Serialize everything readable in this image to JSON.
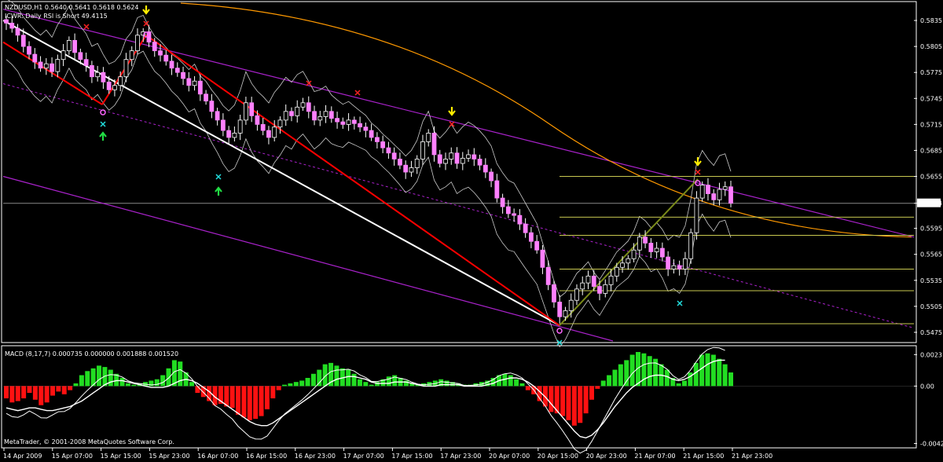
{
  "chart_data": {
    "type": "candlestick",
    "header": {
      "symbol_line": "NZDUSD,H1  0.5640 0.5641 0.5618 0.5624",
      "indicator_line": "ICWR: Daily RSI is Short 49.4115"
    },
    "price_axis": {
      "ticks": [
        "0.5835",
        "0.5805",
        "0.5775",
        "0.5745",
        "0.5715",
        "0.5685",
        "0.5655",
        "0.5624",
        "0.5595",
        "0.5565",
        "0.5535",
        "0.5505",
        "0.5475"
      ],
      "current_price": "0.5624",
      "ylim": [
        0.5465,
        0.5855
      ]
    },
    "macd": {
      "label": "MACD  (8,17,7) 0.000735 0.000000 0.001888 0.001520",
      "ticks": [
        "0.00231",
        "0.00",
        "-0.00421"
      ],
      "ylim": [
        -0.0043,
        0.0025
      ],
      "histogram": [
        -0.0009,
        -0.0012,
        -0.0011,
        -0.0009,
        -0.0005,
        -0.001,
        -0.0014,
        -0.0012,
        -0.0007,
        -0.0004,
        -0.0006,
        -0.0003,
        0.0002,
        0.0008,
        0.0011,
        0.0013,
        0.0015,
        0.0014,
        0.0012,
        0.0009,
        0.0006,
        0.0002,
        0.0001,
        0.0002,
        0.0003,
        0.0004,
        0.0005,
        0.0008,
        0.0013,
        0.0019,
        0.0018,
        0.001,
        0.0003,
        -0.0005,
        -0.0008,
        -0.0011,
        -0.0014,
        -0.0013,
        -0.0015,
        -0.0016,
        -0.0021,
        -0.0023,
        -0.0025,
        -0.0024,
        -0.0022,
        -0.0017,
        -0.0009,
        -0.0003,
        0.0001,
        0.0002,
        0.0003,
        0.0004,
        0.0006,
        0.0009,
        0.0012,
        0.0016,
        0.0017,
        0.0015,
        0.0013,
        0.0012,
        0.0009,
        0.0005,
        0.0003,
        0.0001,
        0.0003,
        0.0005,
        0.0007,
        0.0008,
        0.0006,
        0.0004,
        0.0002,
        0.0001,
        0.0002,
        0.0003,
        0.0004,
        0.0005,
        0.0004,
        0.0003,
        0.0002,
        0.0001,
        0.0001,
        0.0002,
        0.0003,
        0.0004,
        0.0006,
        0.0008,
        0.0009,
        0.0008,
        0.0005,
        0.0002,
        -0.0003,
        -0.0006,
        -0.0011,
        -0.0015,
        -0.0019,
        -0.002,
        -0.0022,
        -0.0025,
        -0.0029,
        -0.0027,
        -0.002,
        -0.001,
        -0.0002,
        0.0004,
        0.0008,
        0.0012,
        0.0016,
        0.0019,
        0.0023,
        0.0025,
        0.0024,
        0.0022,
        0.002,
        0.0016,
        0.0012,
        0.0006,
        0.0002,
        0.0004,
        0.001,
        0.0017,
        0.0023,
        0.0024,
        0.0023,
        0.002,
        0.0016,
        0.001
      ],
      "signal": [
        -0.0016,
        -0.0017,
        -0.0018,
        -0.0017,
        -0.0016,
        -0.0016,
        -0.0017,
        -0.0018,
        -0.0018,
        -0.0017,
        -0.0016,
        -0.0015,
        -0.0013,
        -0.0011,
        -0.0008,
        -0.0005,
        -0.0002,
        0.0001,
        0.0003,
        0.0004,
        0.0004,
        0.0003,
        0.0002,
        0.0001,
        0.0,
        -0.0001,
        -0.0001,
        -0.0001,
        0.0,
        0.0002,
        0.0004,
        0.0005,
        0.0004,
        0.0002,
        -0.0001,
        -0.0004,
        -0.0008,
        -0.0011,
        -0.0014,
        -0.0017,
        -0.002,
        -0.0023,
        -0.0026,
        -0.0028,
        -0.0029,
        -0.0029,
        -0.0027,
        -0.0024,
        -0.0021,
        -0.0018,
        -0.0015,
        -0.0012,
        -0.0009,
        -0.0006,
        -0.0003,
        0.0,
        0.0003,
        0.0005,
        0.0006,
        0.0007,
        0.0007,
        0.0006,
        0.0005,
        0.0003,
        0.0002,
        0.0002,
        0.0002,
        0.0003,
        0.0003,
        0.0003,
        0.0002,
        0.0001,
        0.0,
        0.0,
        0.0,
        0.0001,
        0.0001,
        0.0001,
        0.0001,
        0.0,
        0.0,
        0.0,
        0.0,
        0.0001,
        0.0002,
        0.0004,
        0.0005,
        0.0006,
        0.0006,
        0.0005,
        0.0003,
        0.0,
        -0.0004,
        -0.0008,
        -0.0013,
        -0.0018,
        -0.0023,
        -0.0028,
        -0.0033,
        -0.0037,
        -0.0038,
        -0.0036,
        -0.0032,
        -0.0027,
        -0.0021,
        -0.0015,
        -0.001,
        -0.0005,
        -0.0001,
        0.0002,
        0.0005,
        0.0007,
        0.0008,
        0.0008,
        0.0007,
        0.0005,
        0.0004,
        0.0005,
        0.0007,
        0.001,
        0.0013,
        0.0016,
        0.0018,
        0.0019,
        0.0019
      ]
    },
    "time_axis": {
      "labels": [
        "14 Apr 2009",
        "15 Apr 07:00",
        "15 Apr 15:00",
        "15 Apr 23:00",
        "16 Apr 07:00",
        "16 Apr 15:00",
        "16 Apr 23:00",
        "17 Apr 07:00",
        "17 Apr 15:00",
        "17 Apr 23:00",
        "20 Apr 07:00",
        "20 Apr 15:00",
        "20 Apr 23:00",
        "21 Apr 07:00",
        "21 Apr 15:00",
        "21 Apr 23:00"
      ]
    },
    "candles_close": [
      0.5832,
      0.5826,
      0.5818,
      0.5805,
      0.5796,
      0.5787,
      0.578,
      0.5785,
      0.5776,
      0.579,
      0.58,
      0.5812,
      0.5798,
      0.579,
      0.5783,
      0.577,
      0.5775,
      0.5764,
      0.5755,
      0.576,
      0.577,
      0.579,
      0.58,
      0.5818,
      0.5822,
      0.581,
      0.58,
      0.5795,
      0.5788,
      0.578,
      0.5775,
      0.5768,
      0.576,
      0.5765,
      0.575,
      0.5742,
      0.573,
      0.572,
      0.5708,
      0.57,
      0.5705,
      0.572,
      0.574,
      0.5725,
      0.5715,
      0.5708,
      0.57,
      0.5712,
      0.572,
      0.573,
      0.5725,
      0.5735,
      0.574,
      0.573,
      0.572,
      0.5724,
      0.573,
      0.5722,
      0.5718,
      0.5715,
      0.572,
      0.5716,
      0.5712,
      0.5708,
      0.57,
      0.5695,
      0.5688,
      0.5682,
      0.5675,
      0.5668,
      0.566,
      0.5665,
      0.5675,
      0.5695,
      0.5705,
      0.568,
      0.567,
      0.5675,
      0.5682,
      0.567,
      0.5676,
      0.568,
      0.5675,
      0.5668,
      0.566,
      0.565,
      0.563,
      0.562,
      0.5612,
      0.561,
      0.56,
      0.559,
      0.558,
      0.557,
      0.555,
      0.553,
      0.551,
      0.5493,
      0.55,
      0.5512,
      0.5525,
      0.5532,
      0.554,
      0.5528,
      0.552,
      0.553,
      0.554,
      0.555,
      0.5555,
      0.556,
      0.557,
      0.5585,
      0.5578,
      0.5568,
      0.5572,
      0.5562,
      0.5548,
      0.5552,
      0.5548,
      0.556,
      0.559,
      0.563,
      0.5645,
      0.5635,
      0.5628,
      0.564,
      0.5643,
      0.5624
    ],
    "fib_levels": [
      0.5655,
      0.5608,
      0.5587,
      0.5548,
      0.5523,
      0.5485
    ],
    "legend": "MetaTrader, © 2001-2008 MetaQuotes Software Corp.",
    "colors": {
      "bull": "#000000",
      "bear": "#ff80ff",
      "wick": "#ffffff",
      "hist_pos": "#22dd22",
      "hist_neg": "#ff1111",
      "envelope": "#aa22cc",
      "ema": "#ff9900",
      "trend_white": "#ffffff",
      "trend_red": "#ff0000",
      "trend_olive": "#7a8a1a",
      "fib": "#c8c850",
      "bands": "#cccccc"
    }
  }
}
